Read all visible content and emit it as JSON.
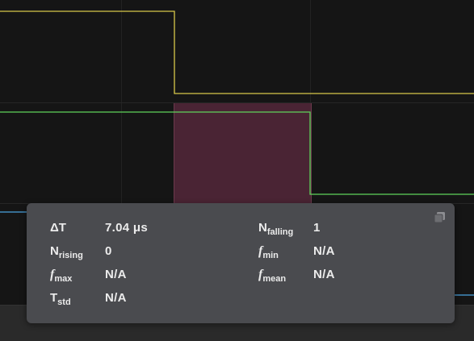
{
  "colors": {
    "background": "#151515",
    "channel_1": "#d8c84a",
    "channel_2": "#5fd35a",
    "channel_3": "#4aa3e0",
    "selection": "#4a2434",
    "panel": "#4a4b4f"
  },
  "measurements": {
    "delta_t": {
      "label_main": "ΔT",
      "label_sub": "",
      "value": "7.04 μs"
    },
    "n_falling": {
      "label_main": "N",
      "label_sub": "falling",
      "value": "1"
    },
    "n_rising": {
      "label_main": "N",
      "label_sub": "rising",
      "value": "0"
    },
    "f_min": {
      "label_main": "f",
      "label_sub": "min",
      "value": "N/A"
    },
    "f_max": {
      "label_main": "f",
      "label_sub": "max",
      "value": "N/A"
    },
    "f_mean": {
      "label_main": "f",
      "label_sub": "mean",
      "value": "N/A"
    },
    "t_std": {
      "label_main": "T",
      "label_sub": "std",
      "value": "N/A"
    }
  },
  "icons": {
    "copy": "copy-icon"
  }
}
